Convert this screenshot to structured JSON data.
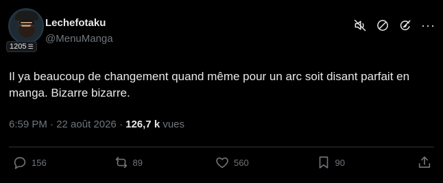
{
  "author": {
    "name": "Lechefotaku",
    "handle": "@MenuManga",
    "badge_count": "1205"
  },
  "header_actions": {
    "icons": [
      "mute-icon",
      "block-icon",
      "grok-icon",
      "more-icon"
    ],
    "more_label": "···"
  },
  "tweet": {
    "text": "Il ya beaucoup de changement quand même pour un arc soit disant parfait en manga. Bizarre bizarre.",
    "time": "6:59 PM · 22 août 2026 · ",
    "views_count": "126,7 k",
    "views_label": " vues"
  },
  "actions": {
    "replies": "156",
    "reposts": "89",
    "likes": "560",
    "bookmarks": "90"
  },
  "colors": {
    "background": "#000000",
    "text": "#e7e9ea",
    "secondary": "#71767b",
    "divider": "#2f3336"
  }
}
